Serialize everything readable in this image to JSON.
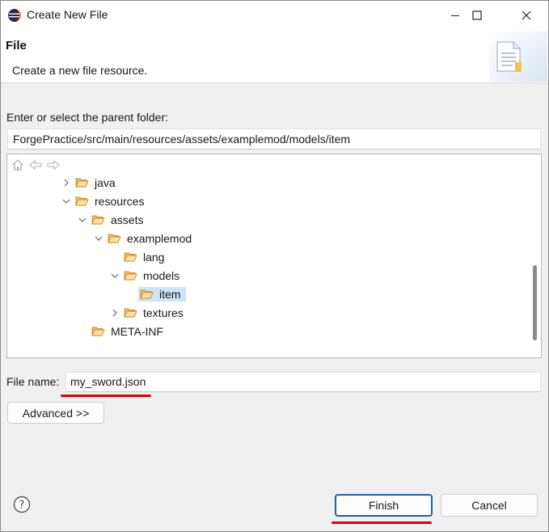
{
  "window": {
    "title": "Create New File",
    "icons": {
      "app": "eclipse-icon",
      "minimize": "minimize-icon",
      "maximize": "maximize-icon",
      "close": "close-icon"
    }
  },
  "banner": {
    "title": "File",
    "description": "Create a new file resource.",
    "icon": "new-file-document-icon"
  },
  "parent_folder": {
    "label": "Enter or select the parent folder:",
    "value": "ForgePractice/src/main/resources/assets/examplemod/models/item"
  },
  "tree": {
    "toolbar_icons": [
      "home-icon",
      "back-arrow-icon",
      "forward-arrow-icon"
    ],
    "items": [
      {
        "label": "java",
        "expander": "collapsed"
      },
      {
        "label": "resources",
        "expander": "expanded"
      },
      {
        "label": "assets",
        "expander": "expanded"
      },
      {
        "label": "examplemod",
        "expander": "expanded"
      },
      {
        "label": "lang",
        "expander": "none"
      },
      {
        "label": "models",
        "expander": "expanded"
      },
      {
        "label": "item",
        "expander": "none",
        "selected": true
      },
      {
        "label": "textures",
        "expander": "collapsed"
      },
      {
        "label": "META-INF",
        "expander": "none"
      }
    ]
  },
  "file_name": {
    "label": "File name:",
    "value": "my_sword.json"
  },
  "buttons": {
    "advanced": "Advanced >>",
    "finish": "Finish",
    "cancel": "Cancel",
    "help_icon": "help-question-icon"
  },
  "colors": {
    "annotation_underline": "#e00000",
    "selection": "#cce4f7",
    "primary_border": "#1d5fb5",
    "folder": "#e8a33a"
  }
}
